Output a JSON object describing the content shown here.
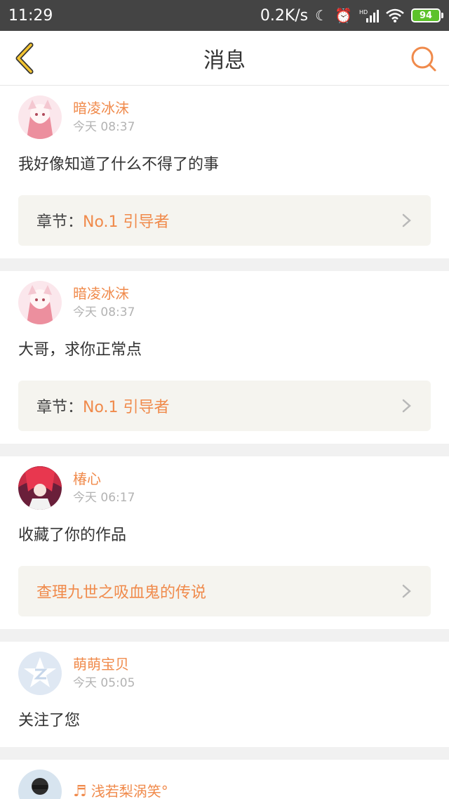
{
  "status_bar": {
    "time": "11:29",
    "net_speed": "0.2K/s",
    "icons": [
      "moon-icon",
      "alarm-icon",
      "hd-signal-icon",
      "wifi-icon"
    ],
    "battery": "94",
    "background": "#444444"
  },
  "nav": {
    "title": "消息",
    "accent": "#f08a4b",
    "back_color": "#f2c331"
  },
  "messages": [
    {
      "user": "暗凌冰沫",
      "time": "今天 08:37",
      "text": "我好像知道了什么不得了的事",
      "link_prefix": "章节：",
      "link_value": "No.1  引导者"
    },
    {
      "user": "暗凌冰沫",
      "time": "今天 08:37",
      "text": "大哥，求你正常点",
      "link_prefix": "章节：",
      "link_value": "No.1  引导者"
    },
    {
      "user": "椿心",
      "time": "今天 06:17",
      "text": "收藏了你的作品",
      "link_prefix": "",
      "link_value": "查理九世之吸血鬼的传说"
    },
    {
      "user": "萌萌宝贝",
      "time": "今天 05:05",
      "text": "关注了您"
    },
    {
      "user": "浅若梨涡笑°",
      "icon": "music-note-icon"
    }
  ]
}
